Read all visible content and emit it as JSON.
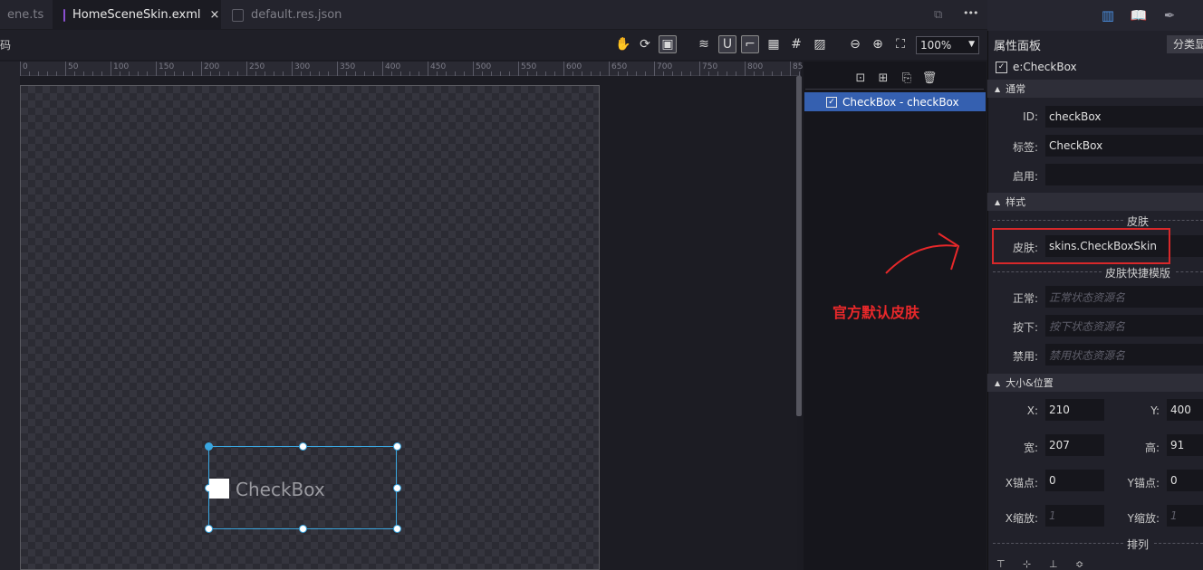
{
  "tabs": [
    {
      "label": "ene.ts",
      "active": false
    },
    {
      "label": "HomeSceneSkin.exml",
      "active": true,
      "close": "×"
    },
    {
      "label": "default.res.json",
      "active": false
    }
  ],
  "tab_actions": {
    "more": "•••"
  },
  "editor_toolbar": {
    "left_label": "码",
    "zoom_value": "100%"
  },
  "ruler_labels": [
    "0",
    "50",
    "100",
    "150",
    "200",
    "250",
    "300",
    "350",
    "400",
    "450",
    "500",
    "550",
    "600",
    "650",
    "700",
    "750",
    "800",
    "85"
  ],
  "canvas": {
    "checkbox_label": "CheckBox"
  },
  "outline": {
    "selected_row": "CheckBox - checkBox"
  },
  "annotation": {
    "text": "官方默认皮肤",
    "color": "#e8282a"
  },
  "props": {
    "title": "属性面板",
    "category_button": "分类显示",
    "component": "e:CheckBox",
    "sections": {
      "general": "通常",
      "style": "样式",
      "size": "大小&位置"
    },
    "general": {
      "id_label": "ID:",
      "id_value": "checkBox",
      "tag_label": "标签:",
      "tag_value": "CheckBox",
      "enabled_label": "启用:",
      "enabled_value": ""
    },
    "style": {
      "skin_heading": "皮肤",
      "skin_label": "皮肤:",
      "skin_value": "skins.CheckBoxSkin",
      "template_heading": "皮肤快捷模版",
      "normal_label": "正常:",
      "normal_placeholder": "正常状态资源名",
      "down_label": "按下:",
      "down_placeholder": "按下状态资源名",
      "disabled_label": "禁用:",
      "disabled_placeholder": "禁用状态资源名"
    },
    "size": {
      "x_label": "X:",
      "x_value": "210",
      "y_label": "Y:",
      "y_value": "400",
      "w_label": "宽:",
      "w_value": "207",
      "h_label": "高:",
      "h_value": "91",
      "ax_label": "X锚点:",
      "ax_value": "0",
      "ay_label": "Y锚点:",
      "ay_value": "0",
      "sx_label": "X缩放:",
      "sx_placeholder": "1",
      "sy_label": "Y缩放:",
      "sy_placeholder": "1",
      "arrange_heading": "排列"
    }
  },
  "colors": {
    "accent": "#3560b0",
    "selection": "#3aa6e0",
    "highlight": "#d8282a"
  }
}
